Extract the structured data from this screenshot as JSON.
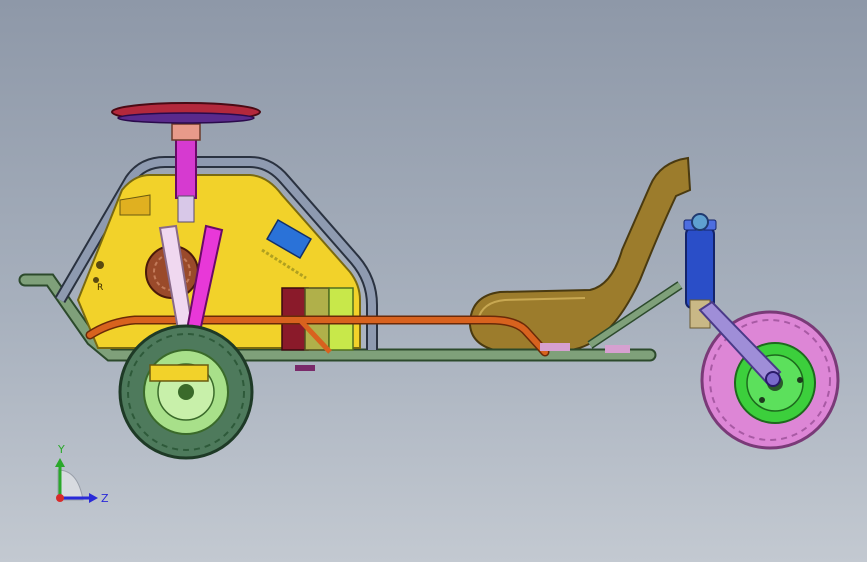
{
  "viewport": {
    "background_top": "#8e98a8",
    "background_bottom": "#c3c9d1"
  },
  "model": {
    "parts": [
      "steering-wheel",
      "steering-column",
      "front-body-panel",
      "tube-frame",
      "orange-rail",
      "seat",
      "battery-box",
      "front-wheel",
      "rear-wheel",
      "rear-shock",
      "swing-arm"
    ],
    "panel_marking": "R",
    "colors": {
      "steering_wheel": "#b3283c",
      "steering_hub": "#5a2a8c",
      "column": "#d63ad0",
      "panel": "#f2d22a",
      "frame": "#6e8e6a",
      "rail": "#d8621e",
      "seat": "#9c7c2c",
      "front_tire": "#4e7a5c",
      "front_rim": "#a8e08a",
      "rear_tire": "#dd86d6",
      "rear_rim": "#3ccf3c",
      "shock": "#2a4ec8",
      "swing_arm": "#9f8ed8",
      "battery_left": "#b0b04a",
      "battery_right": "#c8e84a"
    }
  },
  "triad": {
    "y_label": "Y",
    "z_label": "Z",
    "y_color": "#2aa82a",
    "z_color": "#2a2ad8",
    "x_color": "#d82a2a"
  }
}
